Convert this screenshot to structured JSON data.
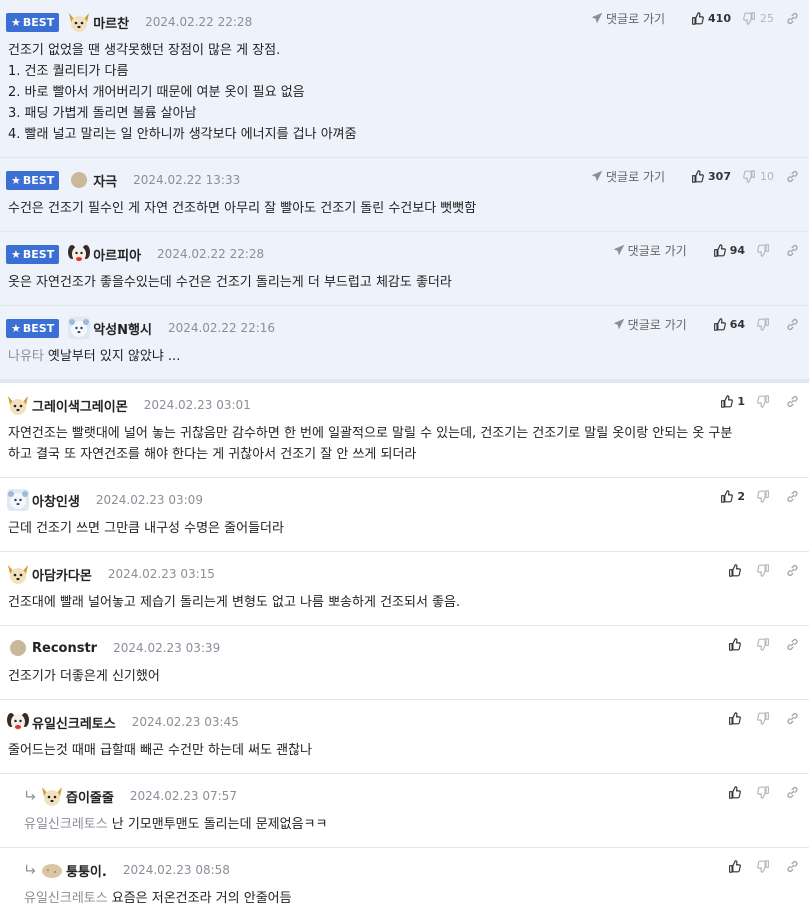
{
  "best_label": "BEST",
  "goto_label": "댓글로 가기",
  "comments": [
    {
      "best": true,
      "avatar": "dog",
      "nick": "마르찬",
      "time": "2024.02.22 22:28",
      "like": "410",
      "dislike": "25",
      "lines": [
        "건조기 없었을 땐 생각못했던 장점이 많은 게 장점.",
        "1. 건조 퀄리티가 다름",
        "2. 바로 빨아서 개어버리기 때문에 여분 옷이 필요 없음",
        "3. 패딩 가볍게 돌리면 볼륨 살아남",
        "4. 빨래 널고 말리는 일 안하니까 생각보다 에너지를 겁나 아껴줌"
      ]
    },
    {
      "best": true,
      "avatar": "round",
      "nick": "자극",
      "time": "2024.02.22 13:33",
      "like": "307",
      "dislike": "10",
      "lines": [
        "수건은 건조기 필수인 게 자연 건조하면 아무리 잘 빨아도 건조기 돌린 수건보다 뻣뻣함"
      ]
    },
    {
      "best": true,
      "avatar": "pup",
      "nick": "아르피아",
      "time": "2024.02.22 22:28",
      "like": "94",
      "dislike": "",
      "lines": [
        "옷은 자연건조가 좋을수있는데 수건은 건조기 돌리는게 더 부드럽고 체감도 좋더라"
      ]
    },
    {
      "best": true,
      "avatar": "bear",
      "nick": "악성N행시",
      "time": "2024.02.22 22:16",
      "like": "64",
      "dislike": "",
      "mention": "나유타",
      "lines": [
        "옛날부터 있지 않았냐 ..."
      ]
    },
    {
      "best": false,
      "avatar": "dog",
      "nick": "그레이색그레이몬",
      "time": "2024.02.23 03:01",
      "like": "1",
      "dislike": "",
      "lines": [
        "자연건조는 빨랫대에 널어 놓는 귀찮음만 감수하면 한 번에 일괄적으로 말릴 수 있는데, 건조기는 건조기로 말릴 옷이랑 안되는 옷 구분",
        "하고 결국 또 자연건조를 해야 한다는 게 귀찮아서 건조기 잘 안 쓰게 되더라"
      ]
    },
    {
      "best": false,
      "avatar": "bear",
      "nick": "아창인생",
      "time": "2024.02.23 03:09",
      "like": "2",
      "dislike": "",
      "lines": [
        "근데 건조기 쓰면 그만큼 내구성 수명은 줄어들더라"
      ]
    },
    {
      "best": false,
      "avatar": "dog",
      "nick": "아담카다몬",
      "time": "2024.02.23 03:15",
      "like": "",
      "dislike": "",
      "lines": [
        "건조대에 빨래 널어놓고 제습기 돌리는게 변형도 없고 나름 뽀송하게 건조되서 좋음."
      ]
    },
    {
      "best": false,
      "avatar": "round",
      "nick": "Reconstr",
      "time": "2024.02.23 03:39",
      "like": "",
      "dislike": "",
      "lines": [
        "건조기가 더좋은게 신기했어"
      ]
    },
    {
      "best": false,
      "avatar": "pup",
      "nick": "유일신크레토스",
      "time": "2024.02.23 03:45",
      "like": "",
      "dislike": "",
      "lines": [
        "줄어드는것 때매 급할때 빼곤 수건만 하는데 써도 괜찮나"
      ]
    },
    {
      "best": false,
      "reply": true,
      "avatar": "dog",
      "nick": "즙이줄줄",
      "time": "2024.02.23 07:57",
      "like": "",
      "dislike": "",
      "mention": "유일신크레토스",
      "lines": [
        "난 기모맨투맨도 돌리는데 문제없음ㅋㅋ"
      ]
    },
    {
      "best": false,
      "reply": true,
      "avatar": "potato",
      "nick": "퉁퉁이.",
      "time": "2024.02.23 08:58",
      "like": "",
      "dislike": "",
      "mention": "유일신크레토스",
      "lines": [
        "요즘은 저온건조라 거의 안줄어듬"
      ]
    }
  ]
}
